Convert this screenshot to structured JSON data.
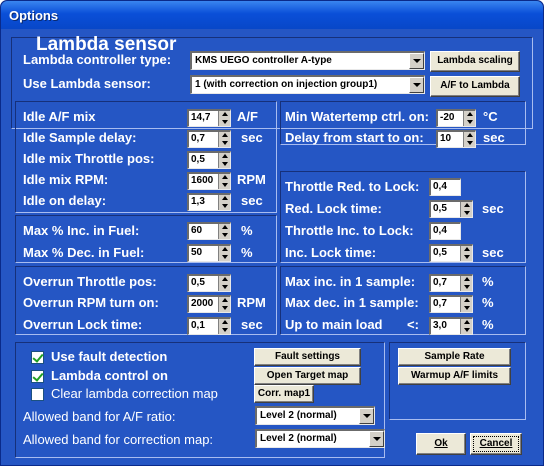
{
  "window": {
    "title": "Options"
  },
  "section_title": "Lambda sensor",
  "lambda_controller": {
    "label": "Lambda controller type:",
    "value": "KMS UEGO controller A-type"
  },
  "use_lambda_sensor": {
    "label": "Use Lambda sensor:",
    "value": "1 (with correction on injection group1)"
  },
  "buttons": {
    "lambda_scaling": "Lambda scaling",
    "af_to_lambda": "A/F to Lambda",
    "fault_settings": "Fault settings",
    "open_target_map": "Open Target map",
    "corr_map1": "Corr. map1",
    "sample_rate": "Sample Rate",
    "warmup_af_limits": "Warmup A/F limits",
    "ok": "Ok",
    "cancel": "Cancel"
  },
  "idle": {
    "af_mix": {
      "label": "Idle A/F mix",
      "value": "14,7",
      "unit": "A/F"
    },
    "sample_delay": {
      "label": "Idle Sample delay:",
      "value": "0,7",
      "unit": "sec"
    },
    "throttle_pos": {
      "label": "Idle mix Throttle pos:",
      "value": "0,5"
    },
    "rpm": {
      "label": "Idle mix RPM:",
      "value": "1600",
      "unit": "RPM"
    },
    "on_delay": {
      "label": "Idle on delay:",
      "value": "1,3",
      "unit": "sec"
    }
  },
  "watertemp": {
    "min": {
      "label": "Min Watertemp ctrl. on:",
      "value": "-20",
      "unit": "°C"
    },
    "delay": {
      "label": "Delay from start to on:",
      "value": "10",
      "unit": "sec"
    }
  },
  "lock": {
    "throttle_red": {
      "label": "Throttle Red. to Lock:",
      "value": "0,4"
    },
    "red_time": {
      "label": "Red. Lock time:",
      "value": "0,5",
      "unit": "sec"
    },
    "throttle_inc": {
      "label": "Throttle Inc. to Lock:",
      "value": "0,4"
    },
    "inc_time": {
      "label": "Inc. Lock time:",
      "value": "0,5",
      "unit": "sec"
    }
  },
  "fuel": {
    "max_inc": {
      "label": "Max % Inc. in Fuel:",
      "value": "60",
      "unit": "%"
    },
    "max_dec": {
      "label": "Max % Dec. in Fuel:",
      "value": "50",
      "unit": "%"
    }
  },
  "overrun": {
    "throttle_pos": {
      "label": "Overrun Throttle pos:",
      "value": "0,5"
    },
    "rpm_on": {
      "label": "Overrun RPM turn on:",
      "value": "2000",
      "unit": "RPM"
    },
    "lock_time": {
      "label": "Overrun Lock time:",
      "value": "0,1",
      "unit": "sec"
    }
  },
  "sample": {
    "max_inc": {
      "label": "Max inc. in 1 sample:",
      "value": "0,7",
      "unit": "%"
    },
    "max_dec": {
      "label": "Max dec. in 1 sample:",
      "value": "0,7",
      "unit": "%"
    },
    "main_load": {
      "label": "Up to main load",
      "op": "<:",
      "value": "3,0",
      "unit": "%"
    }
  },
  "options": {
    "fault_detection": {
      "label": "Use fault detection",
      "checked": true
    },
    "lambda_control": {
      "label": "Lambda control on",
      "checked": true
    },
    "clear_map": {
      "label": "Clear lambda correction map",
      "checked": false
    }
  },
  "band_af": {
    "label": "Allowed band for A/F ratio:",
    "value": "Level 2 (normal)"
  },
  "band_corr": {
    "label": "Allowed band for correction map:",
    "value": "Level 2 (normal)"
  }
}
